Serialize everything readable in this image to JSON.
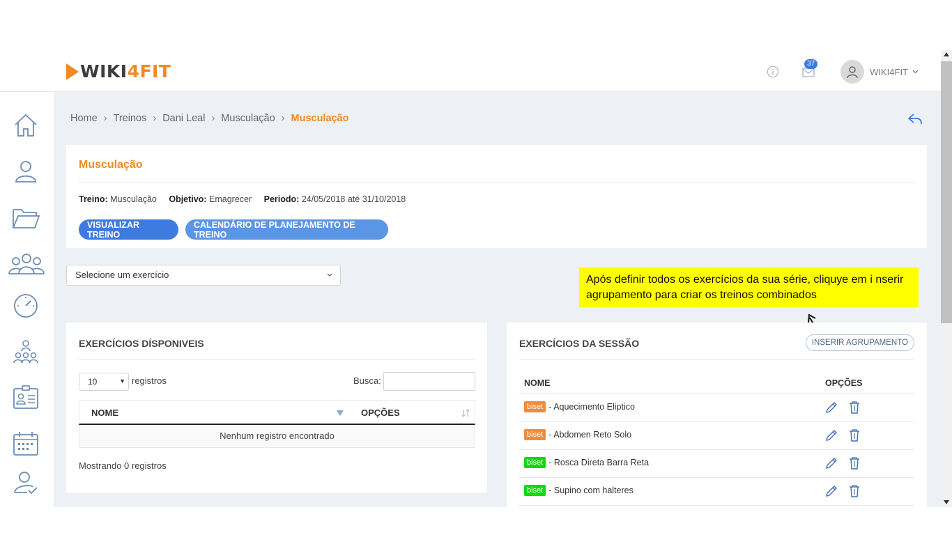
{
  "header": {
    "logo_part1": "WIKI",
    "logo_part2": "4FIT",
    "notification_count": "37",
    "user_name": "WIKI4FIT"
  },
  "sidebar": {
    "icons": [
      "home-icon",
      "user-icon",
      "folder-icon",
      "group-icon",
      "speedometer-icon",
      "hierarchy-icon",
      "id-card-icon",
      "calendar-icon",
      "user-check-icon"
    ]
  },
  "breadcrumb": {
    "items": [
      "Home",
      "Treinos",
      "Dani Leal",
      "Musculação"
    ],
    "active": "Musculação"
  },
  "workout": {
    "title": "Musculação",
    "treino_label": "Treino:",
    "treino_value": "Musculação",
    "objetivo_label": "Objetivo:",
    "objetivo_value": "Emagrecer",
    "periodo_label": "Periodo:",
    "periodo_value": "24/05/2018 até 31/10/2018",
    "btn_visualizar": "VISUALIZAR TREINO",
    "btn_calendario": "CALENDÁRIO DE PLANEJAMENTO DE TREINO"
  },
  "exercise_select": {
    "value": "Selecione um exercício"
  },
  "tooltip": {
    "text": "Após definir todos os exercícios da sua série, cliquye em i nserir agrupamento para criar os treinos combinados"
  },
  "available": {
    "title": "EXERCÍCIOS DÍSPONIVEIS",
    "page_length": "10",
    "length_label": "registros",
    "search_label": "Busca:",
    "columns": [
      "NOME",
      "OPÇÕES"
    ],
    "empty_text": "Nenhum registro encontrado",
    "info": "Mostrando 0 registros"
  },
  "session": {
    "title": "EXERCÍCIOS DA SESSÃO",
    "insert_button": "INSERIR AGRUPAMENTO",
    "columns": [
      "NOME",
      "OPÇÕES"
    ],
    "rows": [
      {
        "tag": "biset",
        "tag_color": "#f08a3c",
        "name": "- Aquecimento Eliptico"
      },
      {
        "tag": "biset",
        "tag_color": "#f08a3c",
        "name": "- Abdomen Reto Solo"
      },
      {
        "tag": "biset",
        "tag_color": "#12d812",
        "name": "- Rosca Direta Barra Reta"
      },
      {
        "tag": "biset",
        "tag_color": "#12d812",
        "name": "- Supino com halteres"
      }
    ]
  },
  "colors": {
    "accent": "#f08a24",
    "primary": "#3d7be0",
    "tooltip_bg": "#ffff00"
  }
}
